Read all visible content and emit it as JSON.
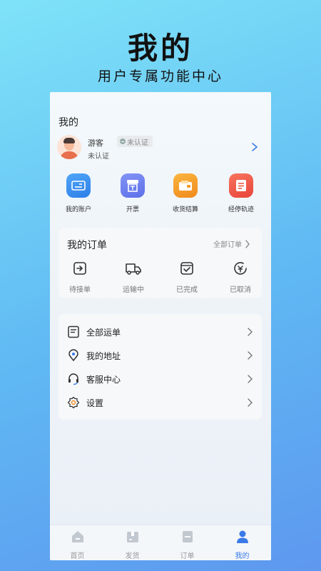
{
  "promo": {
    "title": "我的",
    "subtitle": "用户专属功能中心"
  },
  "page": {
    "title": "我的"
  },
  "profile": {
    "name": "游客",
    "badge": "未认证",
    "status": "未认证"
  },
  "quick_actions": [
    {
      "label": "我的账户",
      "icon": "account-card-icon",
      "color": "#3d8ff0"
    },
    {
      "label": "开票",
      "icon": "invoice-icon",
      "color": "#6a7ff1"
    },
    {
      "label": "收货结算",
      "icon": "wallet-icon",
      "color": "#f49a2a"
    },
    {
      "label": "经停轨迹",
      "icon": "track-doc-icon",
      "color": "#f05a45"
    }
  ],
  "orders": {
    "title": "我的订单",
    "all_label": "全部订单",
    "statuses": [
      {
        "label": "待接单",
        "icon": "pending-order-icon"
      },
      {
        "label": "运输中",
        "icon": "truck-icon"
      },
      {
        "label": "已完成",
        "icon": "completed-check-icon"
      },
      {
        "label": "已取消",
        "icon": "cancelled-yen-icon"
      }
    ]
  },
  "menu": [
    {
      "label": "全部运单",
      "icon": "waybill-list-icon"
    },
    {
      "label": "我的地址",
      "icon": "location-pin-icon"
    },
    {
      "label": "客服中心",
      "icon": "headset-icon"
    },
    {
      "label": "设置",
      "icon": "settings-gear-icon"
    }
  ],
  "tabbar": [
    {
      "label": "首页",
      "icon": "home-icon",
      "active": false
    },
    {
      "label": "发货",
      "icon": "ship-box-icon",
      "active": false
    },
    {
      "label": "订单",
      "icon": "order-icon",
      "active": false
    },
    {
      "label": "我的",
      "icon": "user-icon",
      "active": true
    }
  ],
  "colors": {
    "accent": "#3a7ae8",
    "inactive": "#c2c8d0"
  }
}
